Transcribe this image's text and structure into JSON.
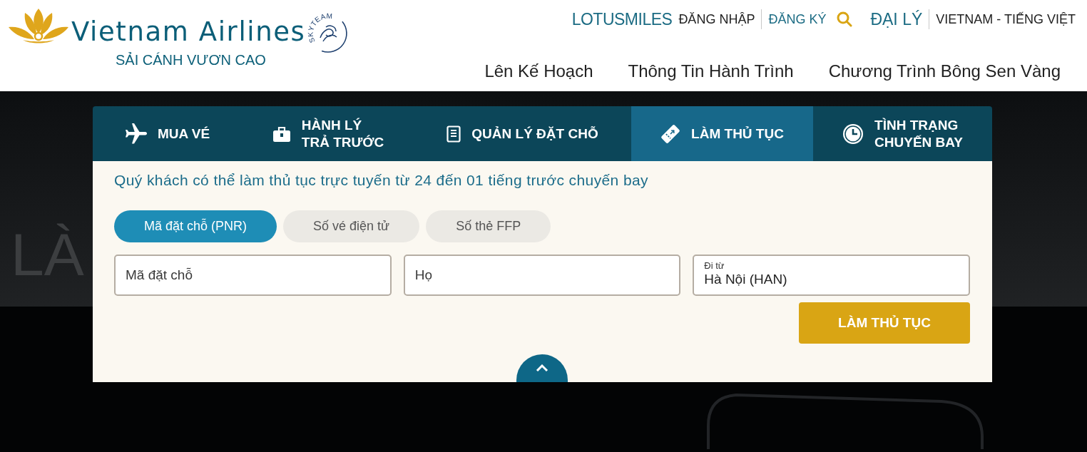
{
  "header": {
    "logo": {
      "brand": "Vietnam Airlines",
      "tagline": "SẢI CÁNH VƯƠN CAO",
      "alliance": "SKYTEAM"
    },
    "top_links": [
      {
        "kind": "brand",
        "label": "LOTUSMILES",
        "divider_before": false
      },
      {
        "kind": "plain",
        "label": "ĐĂNG NHẬP",
        "divider_before": false
      },
      {
        "kind": "accent",
        "label": "ĐĂNG KÝ",
        "divider_before": true
      },
      {
        "kind": "search",
        "divider_before": false
      },
      {
        "kind": "large",
        "label": "ĐẠI LÝ",
        "divider_before": false
      },
      {
        "kind": "plain",
        "label": "VIETNAM - TIẾNG VIỆT",
        "divider_before": true
      }
    ],
    "nav": [
      "Lên Kế Hoạch",
      "Thông Tin Hành Trình",
      "Chương Trình Bông Sen Vàng"
    ]
  },
  "hero": {
    "heading": "LÀ"
  },
  "booking_panel": {
    "tabs": [
      {
        "kind": "flight",
        "lines": [
          "MUA VÉ"
        ],
        "selected": false
      },
      {
        "kind": "baggage",
        "lines": [
          "HÀNH LÝ",
          "TRẢ TRƯỚC"
        ],
        "selected": false
      },
      {
        "kind": "booking",
        "lines": [
          "QUẢN LÝ ĐẶT CHỖ"
        ],
        "selected": false
      },
      {
        "kind": "checkin",
        "lines": [
          "LÀM THỦ TỤC"
        ],
        "selected": true
      },
      {
        "kind": "status",
        "lines": [
          "TÌNH TRẠNG",
          "CHUYẾN BAY"
        ],
        "selected": false
      }
    ],
    "notice": "Quý khách có thể làm thủ tục trực tuyến từ 24 đến 01 tiếng trước chuyến bay",
    "lookup_options": [
      {
        "label": "Mã đặt chỗ (PNR)",
        "selected": true
      },
      {
        "label": "Số vé điện tử",
        "selected": false
      },
      {
        "label": "Số thẻ FFP",
        "selected": false
      }
    ],
    "fields": [
      {
        "kind": "input",
        "placeholder": "Mã đặt chỗ"
      },
      {
        "kind": "input",
        "placeholder": "Họ"
      },
      {
        "kind": "floating",
        "label": "Đi từ",
        "value": "Hà Nội (HAN)"
      }
    ],
    "submit": "LÀM THỦ TỤC"
  }
}
